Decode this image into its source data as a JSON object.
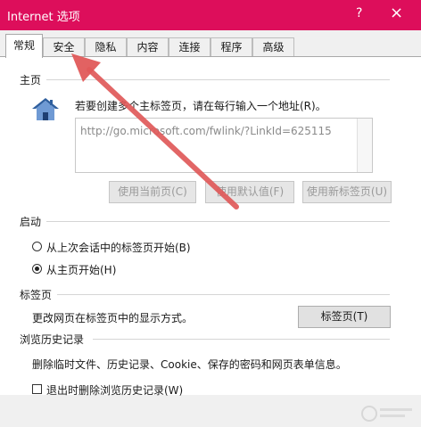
{
  "window": {
    "title": "Internet 选项",
    "help": "?",
    "close": "×"
  },
  "tabs": [
    {
      "label": "常规",
      "active": true
    },
    {
      "label": "安全"
    },
    {
      "label": "隐私"
    },
    {
      "label": "内容"
    },
    {
      "label": "连接"
    },
    {
      "label": "程序"
    },
    {
      "label": "高级"
    }
  ],
  "home": {
    "header": "主页",
    "prompt": "若要创建多个主标签页，请在每行输入一个地址(R)。",
    "url": "http://go.microsoft.com/fwlink/?LinkId=625115",
    "buttons": {
      "current": "使用当前页(C)",
      "default": "使用默认值(F)",
      "new_tab": "使用新标签页(U)"
    }
  },
  "startup": {
    "header": "启动",
    "option_last_session": "从上次会话中的标签页开始(B)",
    "option_home": "从主页开始(H)",
    "selected": "option_home"
  },
  "tabs_section": {
    "header": "标签页",
    "description": "更改网页在标签页中的显示方式。",
    "button": "标签页(T)"
  },
  "history": {
    "header": "浏览历史记录",
    "description": "删除临时文件、历史记录、Cookie、保存的密码和网页表单信息。",
    "checkbox_label": "退出时删除浏览历史记录(W)",
    "checkbox_checked": false
  },
  "colors": {
    "titlebar": "#dd0e5b",
    "annotation_arrow": "#e05a5a"
  }
}
